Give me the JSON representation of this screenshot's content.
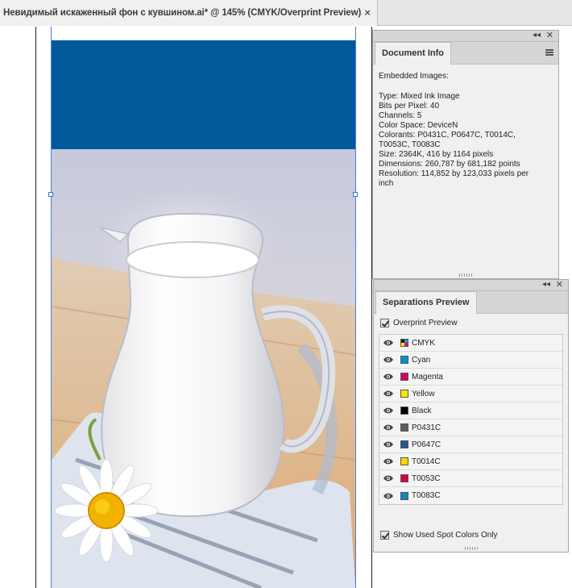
{
  "document_tab": {
    "title": "Невидимый искаженный фон с кувшином.ai* @ 145% (CMYK/Overprint Preview)",
    "close": "×"
  },
  "colors": {
    "band": "#005a9c",
    "selection": "#3b6fd8"
  },
  "document_info": {
    "tab": "Document Info",
    "heading": "Embedded Images:",
    "lines": [
      "Type: Mixed Ink Image",
      "Bits per Pixel: 40",
      "Channels: 5",
      "Color Space: DeviceN",
      "Colorants: P0431C, P0647C, T0014C,",
      "T0053C, T0083C",
      "Size: 2364K, 416 by 1164 pixels",
      "Dimensions: 260,787 by 681,182 points",
      "Resolution: 114,852 by 123,033 pixels per",
      "inch"
    ]
  },
  "separations": {
    "tab": "Separations Preview",
    "overprint_label": "Overprint Preview",
    "show_used_label": "Show Used Spot Colors Only",
    "items": [
      {
        "label": "CMYK",
        "color": "cmyk"
      },
      {
        "label": "Cyan",
        "color": "#0091d5"
      },
      {
        "label": "Magenta",
        "color": "#d5005d"
      },
      {
        "label": "Yellow",
        "color": "#ffe600"
      },
      {
        "label": "Black",
        "color": "#000000"
      },
      {
        "label": "P0431C",
        "color": "#5a5e66"
      },
      {
        "label": "P0647C",
        "color": "#1f5a93"
      },
      {
        "label": "T0014C",
        "color": "#ffd600"
      },
      {
        "label": "T0053C",
        "color": "#d6004a"
      },
      {
        "label": "T0083C",
        "color": "#1188c8"
      }
    ]
  }
}
